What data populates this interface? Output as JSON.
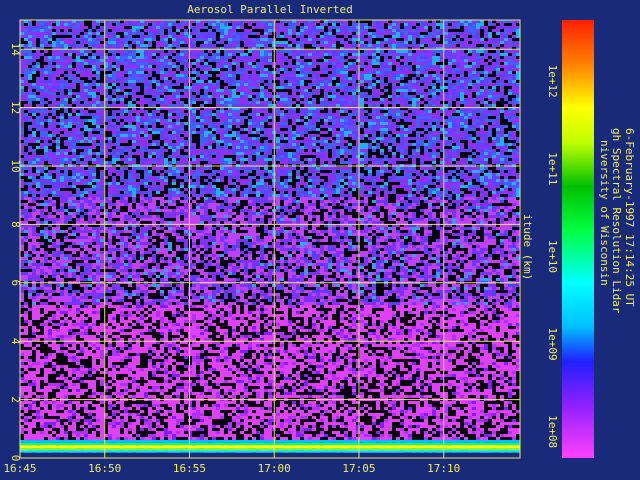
{
  "chart_data": {
    "type": "heatmap",
    "title": "Aerosol Parallel Inverted",
    "ylabel": "itude (km)",
    "xlabel": "",
    "x_ticks": [
      "16:45",
      "16:50",
      "16:55",
      "17:00",
      "17:05",
      "17:10"
    ],
    "y_ticks": [
      "0",
      "2",
      "4",
      "6",
      "8",
      "10",
      "12",
      "14"
    ],
    "ylim": [
      0,
      15
    ],
    "x_range": [
      "16:45",
      "17:14"
    ],
    "grid": true,
    "colorbar": {
      "scale": "log",
      "ticks": [
        "1e+12",
        "1e+11",
        "1e+10",
        "1e+09",
        "1e+08"
      ],
      "range": [
        50000000,
        5000000000000
      ]
    },
    "annotation_lines": [
      "niversity of Wisconsin",
      "gh Spectral Resolution Lidar",
      "6-February-1997 17:14:25 UT"
    ]
  },
  "colors": {
    "background": "#1a2a7a",
    "text": "#f0f060",
    "grid": "#e8e870"
  }
}
